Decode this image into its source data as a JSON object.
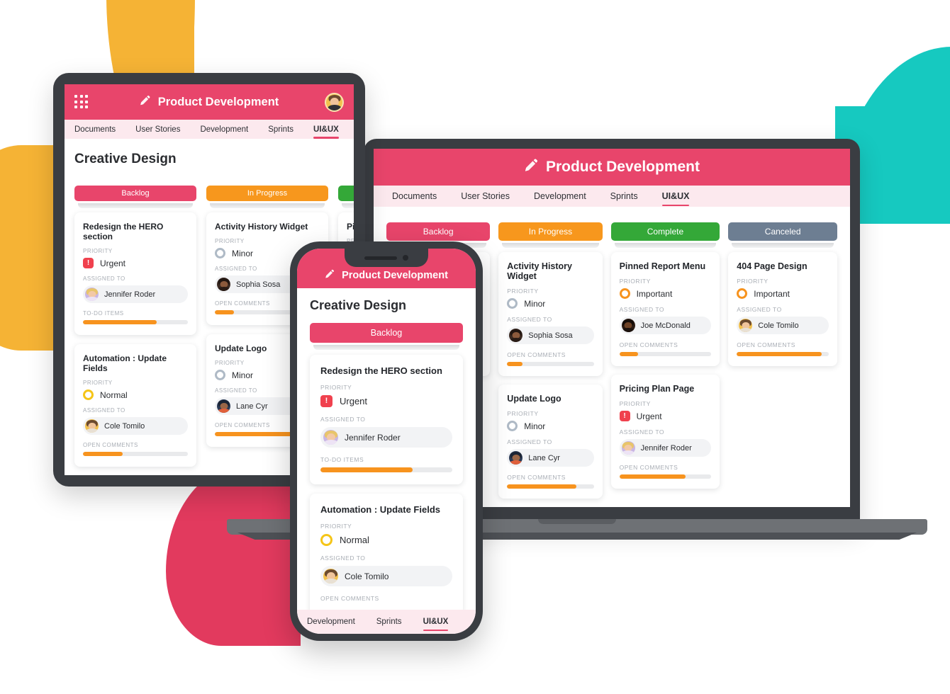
{
  "app": {
    "title": "Product Development",
    "board_title": "Creative Design",
    "grid_icon": "apps-grid-icon",
    "pen_icon": "pencil-icon",
    "avatar_icon": "user-avatar"
  },
  "tabs": {
    "full": [
      {
        "label": "Documents",
        "active": false
      },
      {
        "label": "User Stories",
        "active": false
      },
      {
        "label": "Development",
        "active": false
      },
      {
        "label": "Sprints",
        "active": false
      },
      {
        "label": "UI&UX",
        "active": true
      }
    ],
    "phone": [
      {
        "label": "Development",
        "active": false
      },
      {
        "label": "Sprints",
        "active": false
      },
      {
        "label": "UI&UX",
        "active": true
      }
    ]
  },
  "columns": {
    "backlog": {
      "label": "Backlog",
      "color": "#E8456B"
    },
    "progress": {
      "label": "In Progress",
      "color": "#F7971D"
    },
    "complete": {
      "label": "Complete",
      "color": "#34A838"
    },
    "canceled": {
      "label": "Canceled",
      "color": "#6D7E92"
    }
  },
  "labels": {
    "priority": "PRIORITY",
    "assigned_to": "ASSIGNED TO",
    "todo_items": "TO-DO ITEMS",
    "open_comments": "OPEN COMMENTS"
  },
  "priority_levels": {
    "urgent": {
      "label": "Urgent",
      "glyph": "!",
      "color": "#F0414E"
    },
    "important": {
      "label": "Important",
      "glyph": "",
      "color": "#F7931E"
    },
    "normal": {
      "label": "Normal",
      "glyph": "",
      "color": "#F5C518"
    },
    "minor": {
      "label": "Minor",
      "glyph": "",
      "color": "#AFBAC6"
    }
  },
  "cards": {
    "hero": {
      "title": "Redesign the HERO section",
      "priority": "Urgent",
      "prio_kind": "urgent",
      "assignee": "Jennifer Roder",
      "progress_label": "TO-DO ITEMS",
      "progress": 70
    },
    "automation": {
      "title": "Automation : Update Fields",
      "priority": "Normal",
      "prio_kind": "normal",
      "assignee": "Cole Tomilo",
      "progress_label": "OPEN COMMENTS",
      "progress": 38
    },
    "activity": {
      "title": "Activity History Widget",
      "priority": "Minor",
      "prio_kind": "minor",
      "assignee": "Sophia Sosa",
      "progress_label": "OPEN COMMENTS",
      "progress": 18
    },
    "updatelogo": {
      "title": "Update Logo",
      "priority": "Minor",
      "prio_kind": "minor",
      "assignee": "Lane Cyr",
      "progress_label": "OPEN COMMENTS",
      "progress": 80
    },
    "pinned": {
      "title": "Pinned Report Menu",
      "priority": "Important",
      "prio_kind": "important",
      "assignee": "Joe McDonald",
      "progress_label": "OPEN COMMENTS",
      "progress": 20
    },
    "pricing": {
      "title": "Pricing Plan Page",
      "priority": "Urgent",
      "prio_kind": "urgent",
      "assignee": "Jennifer Roder",
      "progress_label": "OPEN COMMENTS",
      "progress": 72
    },
    "page404": {
      "title": "404 Page Design",
      "priority": "Important",
      "prio_kind": "important",
      "assignee": "Cole Tomilo",
      "progress_label": "OPEN COMMENTS",
      "progress": 92
    }
  },
  "theme": {
    "brand_pink": "#E8456B",
    "orange": "#F7931E",
    "green": "#34A838",
    "slate": "#6D7E92",
    "red": "#F0414E",
    "yellow": "#F5C518",
    "shape_yellow": "#F5B335",
    "shape_purple": "#8A2BE2",
    "shape_teal": "#16C9C0",
    "shape_pink": "#E23A5E",
    "device_dark": "#3A3D42"
  }
}
